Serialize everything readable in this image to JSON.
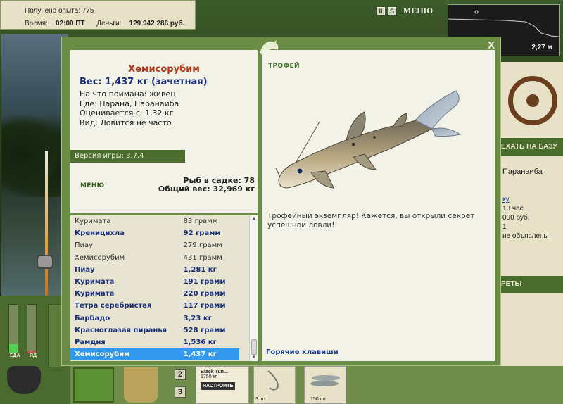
{
  "top_bar": {
    "xp_label": "Получено опыта: 775",
    "time_label": "Время:",
    "time_value": "02:00 ПТ",
    "money_label": "Деньги:",
    "money_value": "129 942 286 руб."
  },
  "top_icons": {
    "pause": "II",
    "sound": "S",
    "menu": "МЕНЮ"
  },
  "depth": {
    "value": "2,27 м"
  },
  "right_panel": {
    "header": "ЕХАТЬ НА БАЗУ",
    "location": "Паранаиба",
    "link": "ку",
    "line1": "13 час.",
    "line2": "000 руб.",
    "line3": "1",
    "line4": "ие объявлены",
    "header2": "РЕТЫ"
  },
  "meters": {
    "food_label": "ЕДА",
    "fatigue_label": "ЯД",
    "food_level": 0.18,
    "fatigue_level": 0.05
  },
  "slots": {
    "s2": "2",
    "s3": "3"
  },
  "lure": {
    "name": "Black Tun...",
    "weight": "1750 кг",
    "setup": "НАСТРОИТЬ"
  },
  "hook_count": "3 шт.",
  "bait_count": "150 шт.",
  "dialog": {
    "close": "X",
    "fish": {
      "name": "Хемисорубим",
      "weight": "Вес: 1,437 кг (зачетная)",
      "caught_with": "На что поймана: живец",
      "where": "Где: Парана, Паранаиба",
      "valued_from": "Оценивается с: 1,32 кг",
      "kind": "Вид: Ловится не часто"
    },
    "version": "Версия игры: 3.7.4",
    "menu_link": "МЕНЮ",
    "fish_in_keepnet": "Рыб в садке: 78",
    "total_weight": "Общий вес: 32,969 кг",
    "list": [
      {
        "name": "Куримата",
        "weight": "83 грамм",
        "bold": false,
        "selected": false
      },
      {
        "name": "Креницихла",
        "weight": "92 грамм",
        "bold": true,
        "selected": false
      },
      {
        "name": "Пиау",
        "weight": "279 грамм",
        "bold": false,
        "selected": false
      },
      {
        "name": "Хемисорубим",
        "weight": "431 грамм",
        "bold": false,
        "selected": false
      },
      {
        "name": "Пиау",
        "weight": "1,281 кг",
        "bold": true,
        "selected": false
      },
      {
        "name": "Куримата",
        "weight": "191 грамм",
        "bold": true,
        "selected": false
      },
      {
        "name": "Куримата",
        "weight": "220 грамм",
        "bold": true,
        "selected": false
      },
      {
        "name": "Тетра серебристая",
        "weight": "117 грамм",
        "bold": true,
        "selected": false
      },
      {
        "name": "Барбадо",
        "weight": "3,23 кг",
        "bold": true,
        "selected": false
      },
      {
        "name": "Красноглазая пиранья",
        "weight": "528 грамм",
        "bold": true,
        "selected": false
      },
      {
        "name": "Рамдия",
        "weight": "1,536 кг",
        "bold": true,
        "selected": false
      },
      {
        "name": "Хемисорубим",
        "weight": "1,437 кг",
        "bold": true,
        "selected": true
      }
    ],
    "trophy_label": "ТРОФЕЙ",
    "trophy_text": "Трофейный экземпляр! Кажется, вы открыли секрет успешной ловли!",
    "hotkeys": "Горячие клавиши"
  }
}
